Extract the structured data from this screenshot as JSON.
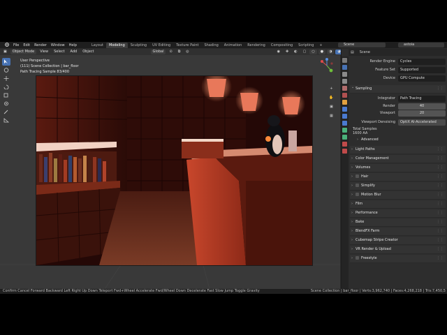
{
  "menubar": {
    "items": [
      "File",
      "Edit",
      "Render",
      "Window",
      "Help"
    ],
    "workspace_tabs": [
      "Layout",
      "Modeling",
      "Sculpting",
      "UV Editing",
      "Texture Paint",
      "Shading",
      "Animation",
      "Rendering",
      "Compositing",
      "Scripting"
    ],
    "active_tab_index": 1,
    "scene": "Scene",
    "view_layer": "astoia"
  },
  "viewport_header": {
    "mode": "Object Mode",
    "menus": [
      "View",
      "Select",
      "Add",
      "Object"
    ],
    "transform_orientation": "Global"
  },
  "overlay": {
    "view_name": "User Perspective",
    "collection": "(111) Scene Collection | bar_floor",
    "status": "Path Tracing Sample 83/400"
  },
  "properties": {
    "context": "Scene",
    "render_engine_label": "Render Engine",
    "render_engine": "Cycles",
    "feature_set_label": "Feature Set",
    "feature_set": "Supported",
    "device_label": "Device",
    "device": "GPU Compute",
    "sampling_label": "Sampling",
    "integrator_label": "Integrator",
    "integrator": "Path Tracing",
    "render_samples_label": "Render",
    "render_samples": "40",
    "viewport_samples_label": "Viewport",
    "viewport_samples": "20",
    "denoising_label": "Viewport Denoising",
    "denoising": "OptiX AI-Accelerated",
    "total_samples_label": "Total Samples",
    "total_samples_value": "1600 AA",
    "advanced_label": "Advanced",
    "panels": [
      "Light Paths",
      "Color Management",
      "Volumes",
      "Hair",
      "Simplify",
      "Motion Blur",
      "Film",
      "Performance",
      "Bake",
      "BlendFX Farm",
      "Cubemap Stripe Creator",
      "VR Render & Upload",
      "Freestyle"
    ]
  },
  "statusbar": {
    "left": "Confirm   Cancel   Forward   Backward   Left   Right   Up   Down   Teleport   Fwd+Wheel Accelerate   Fwd/Wheel Down Decelerate   Fast   Slow   Jump   Toggle Gravity",
    "right": "Scene Collection | bar_floor | Verts:3,962,740 | Faces:4,268,218 | Tris:7,450,5"
  },
  "colors": {
    "accent": "#4772b3",
    "active_tab": "#3d3d3d",
    "render_red": "#a7321d"
  }
}
